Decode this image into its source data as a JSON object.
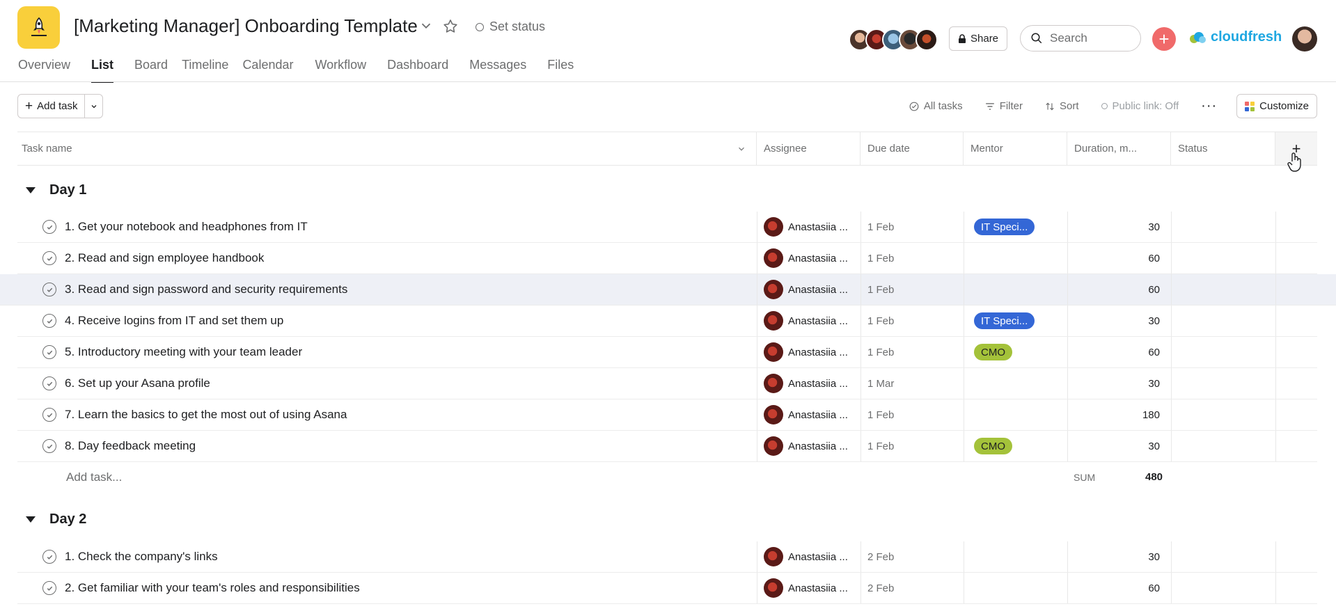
{
  "header": {
    "project_title": "[Marketing Manager] Onboarding Template",
    "set_status": "Set status",
    "share": "Share",
    "search_placeholder": "Search",
    "brand": "cloudfresh"
  },
  "tabs": [
    {
      "label": "Overview"
    },
    {
      "label": "List",
      "active": true
    },
    {
      "label": "Board"
    },
    {
      "label": "Timeline"
    },
    {
      "label": "Calendar"
    },
    {
      "label": "Workflow"
    },
    {
      "label": "Dashboard"
    },
    {
      "label": "Messages"
    },
    {
      "label": "Files"
    }
  ],
  "toolbar": {
    "add_task": "Add task",
    "all_tasks": "All tasks",
    "filter": "Filter",
    "sort": "Sort",
    "public_link": "Public link: Off",
    "customize": "Customize"
  },
  "columns": {
    "task_name": "Task name",
    "assignee": "Assignee",
    "due_date": "Due date",
    "mentor": "Mentor",
    "duration": "Duration, m...",
    "status": "Status"
  },
  "sections": [
    {
      "title": "Day 1",
      "tasks": [
        {
          "name": "1. Get your notebook and headphones from IT",
          "assignee": "Anastasiia ...",
          "due": "1 Feb",
          "mentor": "IT Speci...",
          "duration": "30"
        },
        {
          "name": "2. Read and sign employee handbook",
          "assignee": "Anastasiia ...",
          "due": "1 Feb",
          "mentor": "",
          "duration": "60"
        },
        {
          "name": "3. Read and sign password and security requirements",
          "assignee": "Anastasiia ...",
          "due": "1 Feb",
          "mentor": "",
          "duration": "60"
        },
        {
          "name": "4. Receive logins from IT and set them up",
          "assignee": "Anastasiia ...",
          "due": "1 Feb",
          "mentor": "IT Speci...",
          "duration": "30"
        },
        {
          "name": "5. Introductory meeting with your team leader",
          "assignee": "Anastasiia ...",
          "due": "1 Feb",
          "mentor": "CMO",
          "duration": "60"
        },
        {
          "name": "6. Set up your Asana profile",
          "assignee": "Anastasiia ...",
          "due": "1 Mar",
          "mentor": "",
          "duration": "30"
        },
        {
          "name": "7. Learn the basics to get the most out of using Asana",
          "assignee": "Anastasiia ...",
          "due": "1 Feb",
          "mentor": "",
          "duration": "180"
        },
        {
          "name": "8. Day feedback meeting",
          "assignee": "Anastasiia ...",
          "due": "1 Feb",
          "mentor": "CMO",
          "duration": "30"
        }
      ],
      "add_task": "Add task...",
      "sum_label": "SUM",
      "sum_value": "480"
    },
    {
      "title": "Day 2",
      "tasks": [
        {
          "name": "1. Check the company's links",
          "assignee": "Anastasiia ...",
          "due": "2 Feb",
          "mentor": "",
          "duration": "30"
        },
        {
          "name": "2. Get familiar with your team's roles and responsibilities",
          "assignee": "Anastasiia ...",
          "due": "2 Feb",
          "mentor": "",
          "duration": "60"
        }
      ]
    }
  ],
  "colors": {
    "logo": "#f9cf3b",
    "add_button": "#f06a6a",
    "tag_it": "#3467d6",
    "tag_cmo": "#a4c23a",
    "row_highlight": "#eef0f6"
  },
  "icons": [
    "rocket-icon",
    "chevron-down-icon",
    "star-icon",
    "status-circle-icon",
    "lock-icon",
    "search-icon",
    "plus-icon",
    "cloud-icon",
    "check-circle-icon",
    "filter-icon",
    "sort-icon",
    "more-icon",
    "customize-grid-icon",
    "caret-down-icon",
    "hand-cursor-icon"
  ]
}
